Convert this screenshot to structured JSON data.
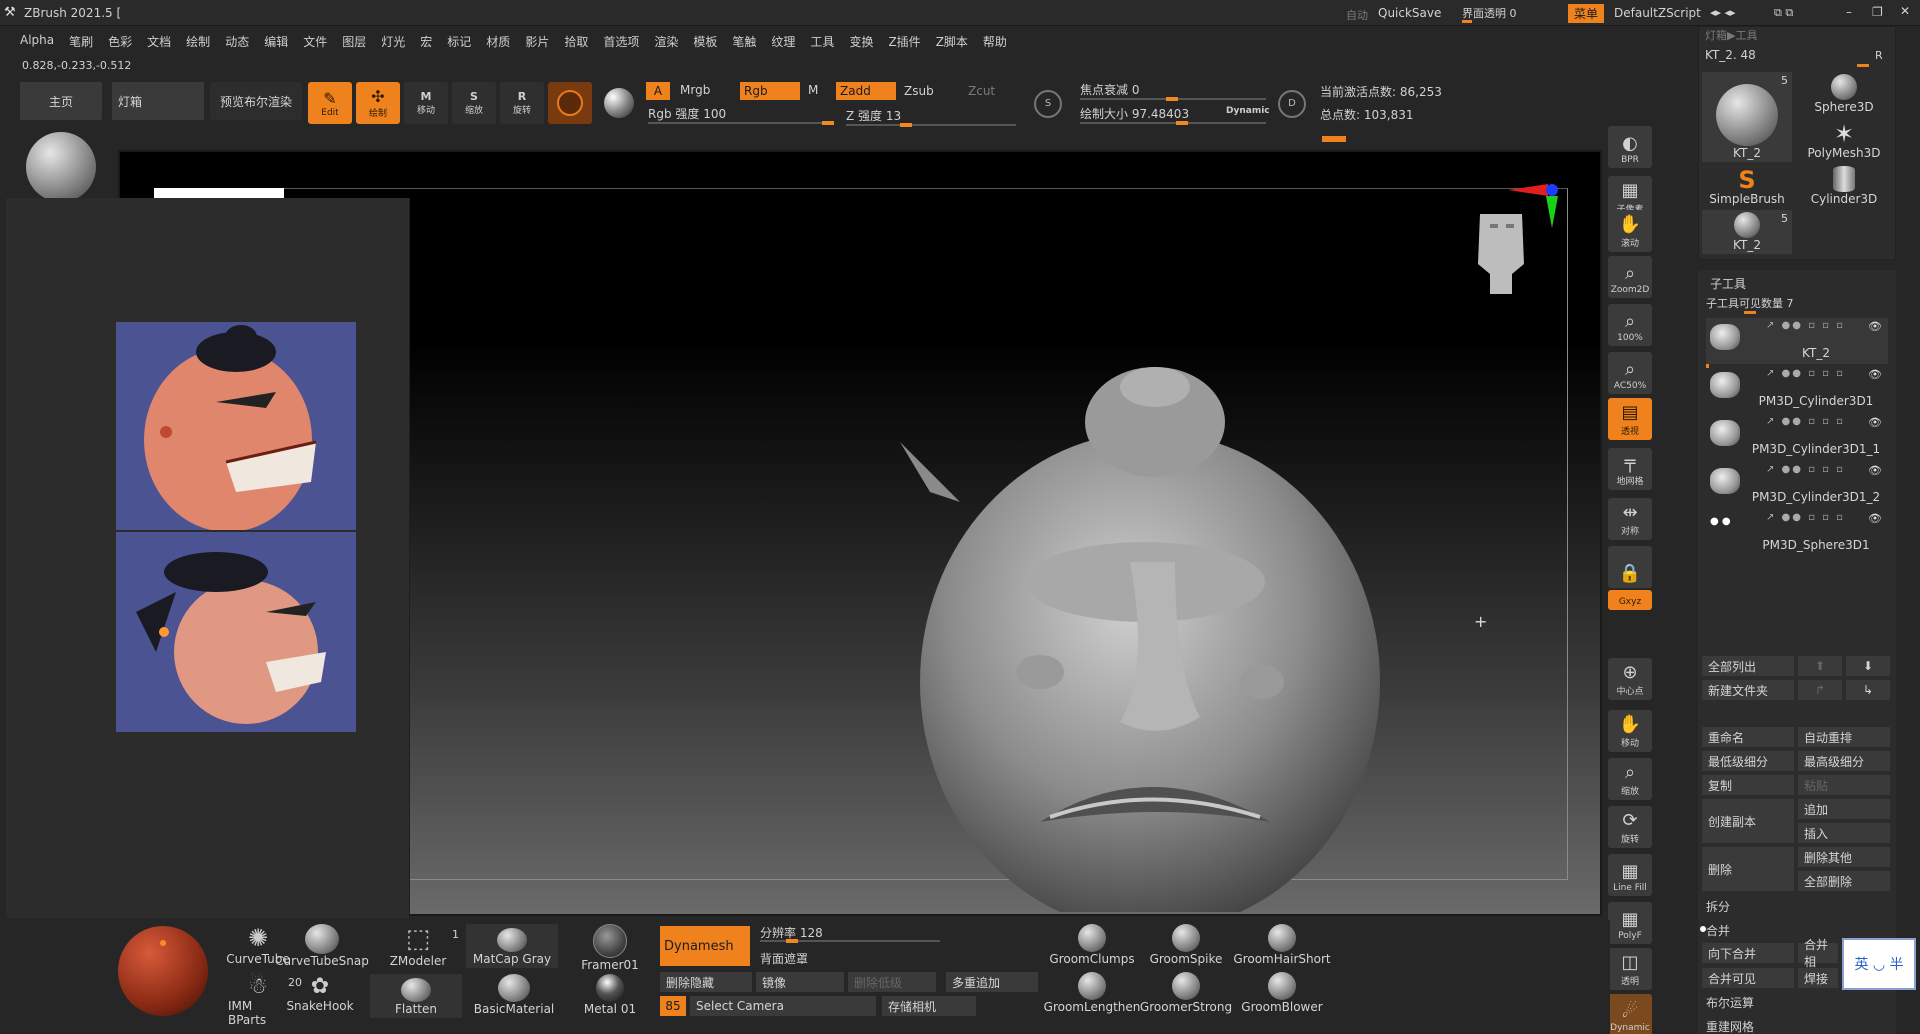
{
  "title_bar": {
    "app_title": "ZBrush 2021.5 [",
    "auto_label": "自动",
    "quicksave": "QuickSave",
    "interface_transparency": "界面透明 0",
    "menu_button": "菜单",
    "default_script": "DefaultZScript"
  },
  "menu_bar": {
    "items": [
      "Alpha",
      "笔刷",
      "色彩",
      "文档",
      "绘制",
      "动态",
      "编辑",
      "文件",
      "图层",
      "灯光",
      "宏",
      "标记",
      "材质",
      "影片",
      "拾取",
      "首选项",
      "渲染",
      "模板",
      "笔触",
      "纹理",
      "工具",
      "变换",
      "Z插件",
      "Z脚本",
      "帮助"
    ]
  },
  "coords": "0.828,-0.233,-0.512",
  "top_shelf": {
    "home_tab": "主页",
    "lightbox_tab": "灯箱",
    "bpr_tab": "预览布尔渲染",
    "edit_label": "Edit",
    "draw_label": "绘制",
    "move_label": "移动",
    "scale_label": "缩放",
    "rotate_label": "旋转",
    "move_key": "M",
    "scale_key": "S",
    "rotate_key": "R",
    "a_label": "A",
    "mrgb": "Mrgb",
    "rgb": "Rgb",
    "m": "M",
    "rgb_intensity": "Rgb 强度 100",
    "zadd": "Zadd",
    "zsub": "Zsub",
    "zcut": "Zcut",
    "z_intensity": "Z 强度 13",
    "focal_shift": "焦点衰减 0",
    "draw_size": "绘制大小 97.48403",
    "dynamic": "Dynamic",
    "active_points": "当前激活点数: 86,253",
    "total_points": "总点数: 103,831"
  },
  "lightbox_panel": {
    "image_alt_top": "warrior-head-render-front",
    "image_alt_bottom": "warrior-head-render-side"
  },
  "right_toolbar": [
    {
      "label": "BPR",
      "icon": "bpr-icon"
    },
    {
      "label": "子像素",
      "icon": "subpixel-icon"
    },
    {
      "label": "滚动",
      "icon": "scroll-icon"
    },
    {
      "label": "Zoom2D",
      "icon": "zoom2d-icon"
    },
    {
      "label": "100%",
      "icon": "zoom100-icon"
    },
    {
      "label": "AC50%",
      "icon": "ac50-icon"
    },
    {
      "label": "透视",
      "icon": "perspective-icon"
    },
    {
      "label": "地网格",
      "icon": "floor-grid-icon"
    },
    {
      "label": "对称",
      "icon": "symmetry-icon"
    },
    {
      "label": "",
      "icon": "lock-icon"
    },
    {
      "label": "Gxyz",
      "icon": "xyz-icon"
    },
    {
      "label": "中心点",
      "icon": "center-point-icon"
    },
    {
      "label": "移动",
      "icon": "move-icon"
    },
    {
      "label": "缩放",
      "icon": "scale-icon"
    },
    {
      "label": "旋转",
      "icon": "rotate-icon"
    },
    {
      "label": "Line Fill",
      "icon": "line-fill-icon"
    },
    {
      "label": "PolyF",
      "icon": "polyframe-icon"
    },
    {
      "label": "透明",
      "icon": "transparent-icon"
    },
    {
      "label": "Dynamic",
      "icon": "dynamic-icon"
    }
  ],
  "tool_panel": {
    "header": "灯箱▶工具",
    "current_tool": "KT_2. 48",
    "r_label": "R",
    "tools": [
      {
        "name": "KT_2",
        "count": "5"
      },
      {
        "name": "Sphere3D",
        "count": ""
      },
      {
        "name": "PolyMesh3D",
        "count": ""
      },
      {
        "name": "SimpleBrush",
        "count": ""
      },
      {
        "name": "Cylinder3D",
        "count": ""
      },
      {
        "name": "KT_2",
        "count": "5"
      }
    ],
    "subtool_title": "子工具",
    "subtool_visible": "子工具可见数量 7",
    "subtools": [
      "KT_2",
      "PM3D_Cylinder3D1",
      "PM3D_Cylinder3D1_1",
      "PM3D_Cylinder3D1_2",
      "PM3D_Sphere3D1"
    ],
    "list_all": "全部列出",
    "new_folder": "新建文件夹",
    "rename": "重命名",
    "auto_reorder": "自动重排",
    "lowest_subdiv": "最低级细分",
    "highest_subdiv": "最高级细分",
    "copy": "复制",
    "paste": "粘贴",
    "duplicate": "创建副本",
    "append": "追加",
    "insert": "插入",
    "delete": "删除",
    "delete_other": "删除其他",
    "delete_all": "全部删除",
    "split": "拆分",
    "merge": "合并",
    "merge_down": "向下合并",
    "merge_similar": "合并相",
    "merge_visible": "合并可见",
    "weld": "焊接",
    "boolean": "布尔运算",
    "remesh": "重建网格",
    "ime_label": "英 ◡ 半"
  },
  "bottom_shelf": {
    "brushes": [
      "CurveTube",
      "CurveTubeSnap",
      "ZModeler",
      "IMM BParts",
      "SnakeHook"
    ],
    "zmodeler_count": "1",
    "imm_count": "20",
    "materials": [
      "MatCap Gray",
      "Framer01",
      "Flatten",
      "BasicMaterial",
      "Metal 01"
    ],
    "dynamesh": "Dynamesh",
    "resolution": "分辨率 128",
    "backface_mask": "背面遮罩",
    "delete_hidden": "删除隐藏",
    "mirror": "镜像",
    "delete_lower": "删除低级",
    "multi_append": "多重追加",
    "camera_value": "85",
    "select_camera": "Select Camera",
    "store_camera": "存储相机",
    "groom_brushes": [
      "GroomClumps",
      "GroomSpike",
      "GroomHairShort",
      "GroomLengthen",
      "GroomerStrong",
      "GroomBlower"
    ]
  },
  "colors": {
    "accent": "#f0821e",
    "bg": "#262626",
    "panel": "#2f2f2f",
    "lightbox_bg": "#4a4f8c"
  }
}
